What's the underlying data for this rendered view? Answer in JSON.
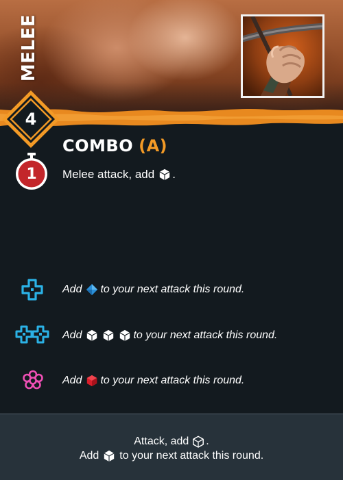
{
  "card": {
    "category": "MELEE",
    "cost": "4",
    "title": "COMBO",
    "tag": "(A)",
    "initiative": "1",
    "text_prefix": "Melee attack, add",
    "text_suffix": "."
  },
  "boosts": [
    {
      "icon": "blue-boost-icon",
      "prefix": "Add",
      "suffix": "to your next attack this round."
    },
    {
      "icon": "double-blue-boost-icon",
      "prefix": "Add",
      "suffix": "to your next attack this round."
    },
    {
      "icon": "pink-boost-icon",
      "prefix": "Add",
      "suffix": "to your next attack this round."
    }
  ],
  "footer": {
    "line1_prefix": "Attack, add",
    "line1_suffix": ".",
    "line2_prefix": "Add",
    "line2_suffix": "to your next attack this round."
  },
  "colors": {
    "background": "#131a1f",
    "accent_orange": "#f39a26",
    "boost_blue": "#2bb2e6",
    "boost_pink": "#ee4fb4",
    "timer_red": "#c3262b",
    "blue_die": "#2a8fd8",
    "red_die": "#d81e2a",
    "footer_bg": "#27323a"
  }
}
